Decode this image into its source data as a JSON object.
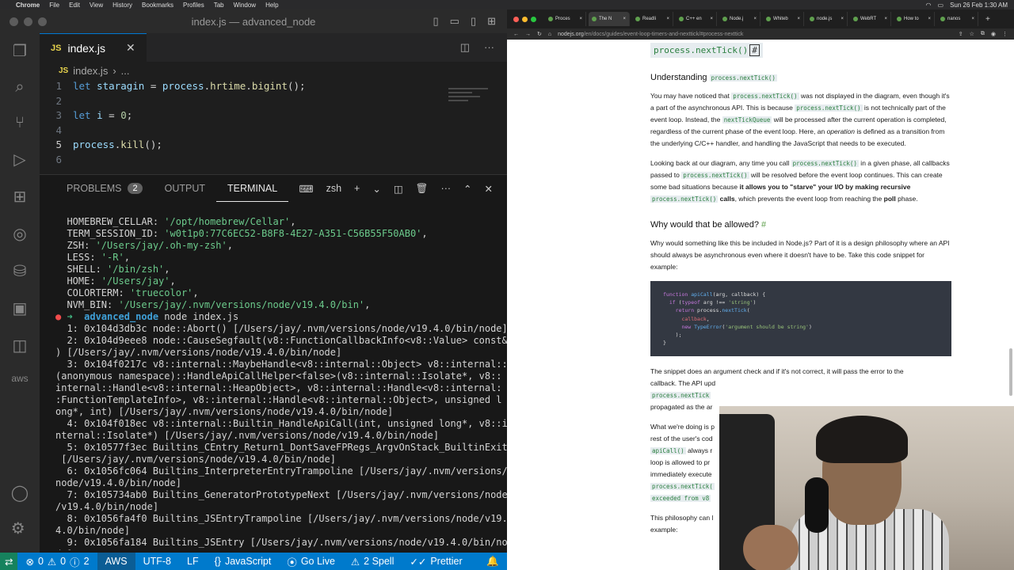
{
  "menubar": {
    "app": "Chrome",
    "items": [
      "File",
      "Edit",
      "View",
      "History",
      "Bookmarks",
      "Profiles",
      "Tab",
      "Window",
      "Help"
    ],
    "clock": "Sun 26 Feb 1:30 AM"
  },
  "vscode": {
    "window_title": "index.js — advanced_node",
    "tab": {
      "icon_label": "JS",
      "name": "index.js"
    },
    "breadcrumb": {
      "file": "index.js",
      "rest": "..."
    },
    "code_lines": [
      {
        "n": "1",
        "parts": [
          [
            "kw",
            "let "
          ],
          [
            "vr",
            "staragin"
          ],
          [
            "tx",
            " = "
          ],
          [
            "vr",
            "process"
          ],
          [
            "tx",
            "."
          ],
          [
            "fn",
            "hrtime"
          ],
          [
            "tx",
            "."
          ],
          [
            "fn",
            "bigint"
          ],
          [
            "tx",
            "();"
          ]
        ]
      },
      {
        "n": "2",
        "parts": []
      },
      {
        "n": "3",
        "parts": [
          [
            "kw",
            "let "
          ],
          [
            "vr",
            "i"
          ],
          [
            "tx",
            " = "
          ],
          [
            "nm",
            "0"
          ],
          [
            "tx",
            ";"
          ]
        ]
      },
      {
        "n": "4",
        "parts": []
      },
      {
        "n": "5",
        "parts": [
          [
            "vr",
            "process"
          ],
          [
            "tx",
            "."
          ],
          [
            "fn",
            "kill"
          ],
          [
            "tx",
            "();"
          ]
        ]
      },
      {
        "n": "6",
        "parts": []
      }
    ],
    "panel": {
      "tabs": {
        "problems": "PROBLEMS",
        "problems_count": "2",
        "output": "OUTPUT",
        "terminal": "TERMINAL",
        "more": "···"
      },
      "shell": "zsh"
    },
    "terminal_lines": [
      [
        [
          "tx",
          "  HOMEBREW_CELLAR: "
        ],
        [
          "s",
          "'/opt/homebrew/Cellar'"
        ],
        [
          "tx",
          ","
        ]
      ],
      [
        [
          "tx",
          "  TERM_SESSION_ID: "
        ],
        [
          "s",
          "'w0t1p0:77C6EC52-B8F8-4E27-A351-C56B55F50AB0'"
        ],
        [
          "tx",
          ","
        ]
      ],
      [
        [
          "tx",
          "  ZSH: "
        ],
        [
          "s",
          "'/Users/jay/.oh-my-zsh'"
        ],
        [
          "tx",
          ","
        ]
      ],
      [
        [
          "tx",
          "  LESS: "
        ],
        [
          "s",
          "'-R'"
        ],
        [
          "tx",
          ","
        ]
      ],
      [
        [
          "tx",
          "  SHELL: "
        ],
        [
          "s",
          "'/bin/zsh'"
        ],
        [
          "tx",
          ","
        ]
      ],
      [
        [
          "tx",
          "  HOME: "
        ],
        [
          "s",
          "'/Users/jay'"
        ],
        [
          "tx",
          ","
        ]
      ],
      [
        [
          "tx",
          "  COLORTERM: "
        ],
        [
          "s",
          "'truecolor'"
        ],
        [
          "tx",
          ","
        ]
      ],
      [
        [
          "tx",
          "  NVM_BIN: "
        ],
        [
          "s",
          "'/Users/jay/.nvm/versions/node/v19.4.0/bin'"
        ],
        [
          "tx",
          ","
        ]
      ],
      [
        [
          "pr-dot",
          "●"
        ],
        [
          "pr-arrow",
          " ➜  "
        ],
        [
          "pr-dir",
          "advanced_node"
        ],
        [
          "tx",
          " node index.js"
        ]
      ],
      [
        [
          "tx",
          "  1: 0x104d3db3c node::Abort() [/Users/jay/.nvm/versions/node/v19.4.0/bin/node]"
        ]
      ],
      [
        [
          "tx",
          "  2: 0x104d9eee8 node::CauseSegfault(v8::FunctionCallbackInfo<v8::Value> const&"
        ]
      ],
      [
        [
          "tx",
          ") [/Users/jay/.nvm/versions/node/v19.4.0/bin/node]"
        ]
      ],
      [
        [
          "tx",
          "  3: 0x104f0217c v8::internal::MaybeHandle<v8::internal::Object> v8::internal::"
        ]
      ],
      [
        [
          "tx",
          "(anonymous namespace)::HandleApiCallHelper<false>(v8::internal::Isolate*, v8::"
        ]
      ],
      [
        [
          "tx",
          "internal::Handle<v8::internal::HeapObject>, v8::internal::Handle<v8::internal:"
        ]
      ],
      [
        [
          "tx",
          ":FunctionTemplateInfo>, v8::internal::Handle<v8::internal::Object>, unsigned l"
        ]
      ],
      [
        [
          "tx",
          "ong*, int) [/Users/jay/.nvm/versions/node/v19.4.0/bin/node]"
        ]
      ],
      [
        [
          "tx",
          "  4: 0x104f018ec v8::internal::Builtin_HandleApiCall(int, unsigned long*, v8::i"
        ]
      ],
      [
        [
          "tx",
          "nternal::Isolate*) [/Users/jay/.nvm/versions/node/v19.4.0/bin/node]"
        ]
      ],
      [
        [
          "tx",
          "  5: 0x10577f3ec Builtins_CEntry_Return1_DontSaveFPRegs_ArgvOnStack_BuiltinExit"
        ]
      ],
      [
        [
          "tx",
          " [/Users/jay/.nvm/versions/node/v19.4.0/bin/node]"
        ]
      ],
      [
        [
          "tx",
          "  6: 0x1056fc064 Builtins_InterpreterEntryTrampoline [/Users/jay/.nvm/versions/"
        ]
      ],
      [
        [
          "tx",
          "node/v19.4.0/bin/node]"
        ]
      ],
      [
        [
          "tx",
          "  7: 0x105734ab0 Builtins_GeneratorPrototypeNext [/Users/jay/.nvm/versions/node"
        ]
      ],
      [
        [
          "tx",
          "/v19.4.0/bin/node]"
        ]
      ],
      [
        [
          "tx",
          "  8: 0x1056fa4f0 Builtins_JSEntryTrampoline [/Users/jay/.nvm/versions/node/v19."
        ]
      ],
      [
        [
          "tx",
          "4.0/bin/node]"
        ]
      ],
      [
        [
          "tx",
          "  9: 0x1056fa184 Builtins_JSEntry [/Users/jay/.nvm/versions/node/v19.4.0/bin/no"
        ]
      ],
      [
        [
          "tx",
          "de]"
        ]
      ]
    ],
    "status": {
      "errors": "0",
      "warnings": "0",
      "info": "2",
      "aws": "AWS",
      "encoding": "UTF-8",
      "eol": "LF",
      "language": "JavaScript",
      "golive": "Go Live",
      "spell": "2 Spell",
      "prettier": "Prettier"
    }
  },
  "browser": {
    "tabs": [
      "Proces",
      "The N",
      "Readli",
      "C++ en",
      "Node.j",
      "Whiteb",
      "node.js",
      "WebRT",
      "How to",
      "nanos"
    ],
    "url_host": "nodejs.org",
    "url_path": "/en/docs/guides/event-loop-timers-and-nexttick/#process-nexttick",
    "heading_code": "process.nextTick()",
    "heading_hash": "#",
    "sec1_title": "Understanding",
    "sec1_code": "process.nextTick()",
    "p1": [
      [
        "t",
        "You may have noticed that "
      ],
      [
        "c",
        "process.nextTick()"
      ],
      [
        "t",
        " was not displayed in the diagram, even though it's a part of the asynchronous API. This is because "
      ],
      [
        "c",
        "process.nextTick()"
      ],
      [
        "t",
        " is not technically part of the event loop. Instead, the "
      ],
      [
        "c",
        "nextTickQueue"
      ],
      [
        "t",
        " will be processed after the current operation is completed, regardless of the current phase of the event loop. Here, an "
      ],
      [
        "i",
        "operation"
      ],
      [
        "t",
        " is defined as a transition from the underlying C/C++ handler, and handling the JavaScript that needs to be executed."
      ]
    ],
    "p2": [
      [
        "t",
        "Looking back at our diagram, any time you call "
      ],
      [
        "c",
        "process.nextTick()"
      ],
      [
        "t",
        " in a given phase, all callbacks passed to "
      ],
      [
        "c",
        "process.nextTick()"
      ],
      [
        "t",
        " will be resolved before the event loop continues. This can create some bad situations because "
      ],
      [
        "b",
        "it allows you to \"starve\" your I/O by making recursive "
      ],
      [
        "c",
        "process.nextTick()"
      ],
      [
        "b",
        " calls"
      ],
      [
        "t",
        ", which prevents the event loop from reaching the "
      ],
      [
        "b",
        "poll"
      ],
      [
        "t",
        " phase."
      ]
    ],
    "sec2_title": "Why would that be allowed?",
    "sec2_hash": "#",
    "p3": "Why would something like this be included in Node.js? Part of it is a design philosophy where an API should always be asynchronous even where it doesn't have to be. Take this code snippet for example:",
    "code_snippet": [
      [
        [
          "k",
          "function "
        ],
        [
          "f",
          "apiCall"
        ],
        [
          "t",
          "(arg, callback) {"
        ]
      ],
      [
        [
          "t",
          "  "
        ],
        [
          "k",
          "if"
        ],
        [
          "t",
          " ("
        ],
        [
          "k",
          "typeof"
        ],
        [
          "t",
          " arg !== "
        ],
        [
          "st",
          "'string'"
        ],
        [
          "t",
          ")"
        ]
      ],
      [
        [
          "t",
          "    "
        ],
        [
          "k",
          "return"
        ],
        [
          "t",
          " process."
        ],
        [
          "f",
          "nextTick"
        ],
        [
          "t",
          "("
        ]
      ],
      [
        [
          "t",
          "      "
        ],
        [
          "p",
          "callback"
        ],
        [
          "t",
          ","
        ]
      ],
      [
        [
          "t",
          "      "
        ],
        [
          "k",
          "new "
        ],
        [
          "f",
          "TypeError"
        ],
        [
          "t",
          "("
        ],
        [
          "st",
          "'argument should be string'"
        ],
        [
          "t",
          ")"
        ]
      ],
      [
        [
          "t",
          "    );"
        ]
      ],
      [
        [
          "t",
          "}"
        ]
      ]
    ],
    "p4a": "The snippet does an argument check and if it's not correct, it will pass the error to the",
    "p4b": "callback. The API upd",
    "p4c_code": "process.nextTick",
    "p4d": "propagated as the ar",
    "p5a": "What we're doing is p",
    "p5b": "rest of the user's cod",
    "p5c_code": "apiCall()",
    "p5c": " always r",
    "p5d": "loop is allowed to pr",
    "p5e": "immediately execute",
    "p5f_code": "process.nextTick(",
    "p5g_code": "exceeded from v8",
    "p6a": "This philosophy can l",
    "p6b": "example:"
  }
}
